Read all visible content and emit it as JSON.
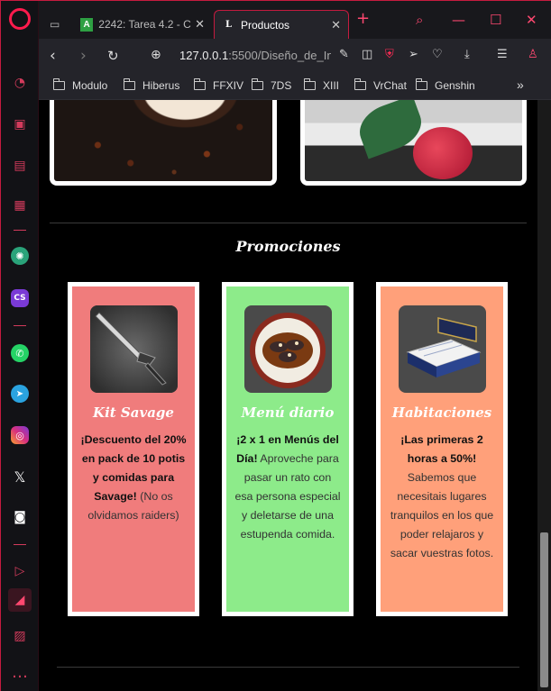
{
  "colors": {
    "accent": "#ff1b4d",
    "card_savage": "#f07c7c",
    "card_menu": "#8deb8a",
    "card_habitaciones": "#ffa07a"
  },
  "tabs": [
    {
      "title": "2242: Tarea 4.2 - C",
      "favicon": "A"
    },
    {
      "title": "Productos",
      "favicon": "L"
    }
  ],
  "address": {
    "url_host": "127.0.0.1",
    "url_path": ":5500/Diseño_de_In"
  },
  "bookmarks": [
    "Modulo",
    "Hiberus",
    "FFXIV",
    "7DS",
    "XIII",
    "VrChat",
    "Genshin"
  ],
  "page": {
    "section_title": "Promociones",
    "cards": [
      {
        "title": "Kit Savage",
        "bold": "¡Descuento del 20% en pack de 10 potis y comidas para Savage!",
        "text": " (No os olvidamos raiders)",
        "image": "sword-image"
      },
      {
        "title": "Menú diario",
        "bold": "¡2 x 1 en Menús del Día!",
        "text": " Aproveche para pasar un rato con esa persona especial y deletarse de una estupenda comida.",
        "image": "dish-image"
      },
      {
        "title": "Habitaciones",
        "bold": "¡Las primeras 2 horas a 50%!",
        "text": " Sabemos que necesitais lugares tranquilos en los que poder relajaros y sacar vuestras fotos.",
        "image": "bed-image"
      }
    ]
  }
}
